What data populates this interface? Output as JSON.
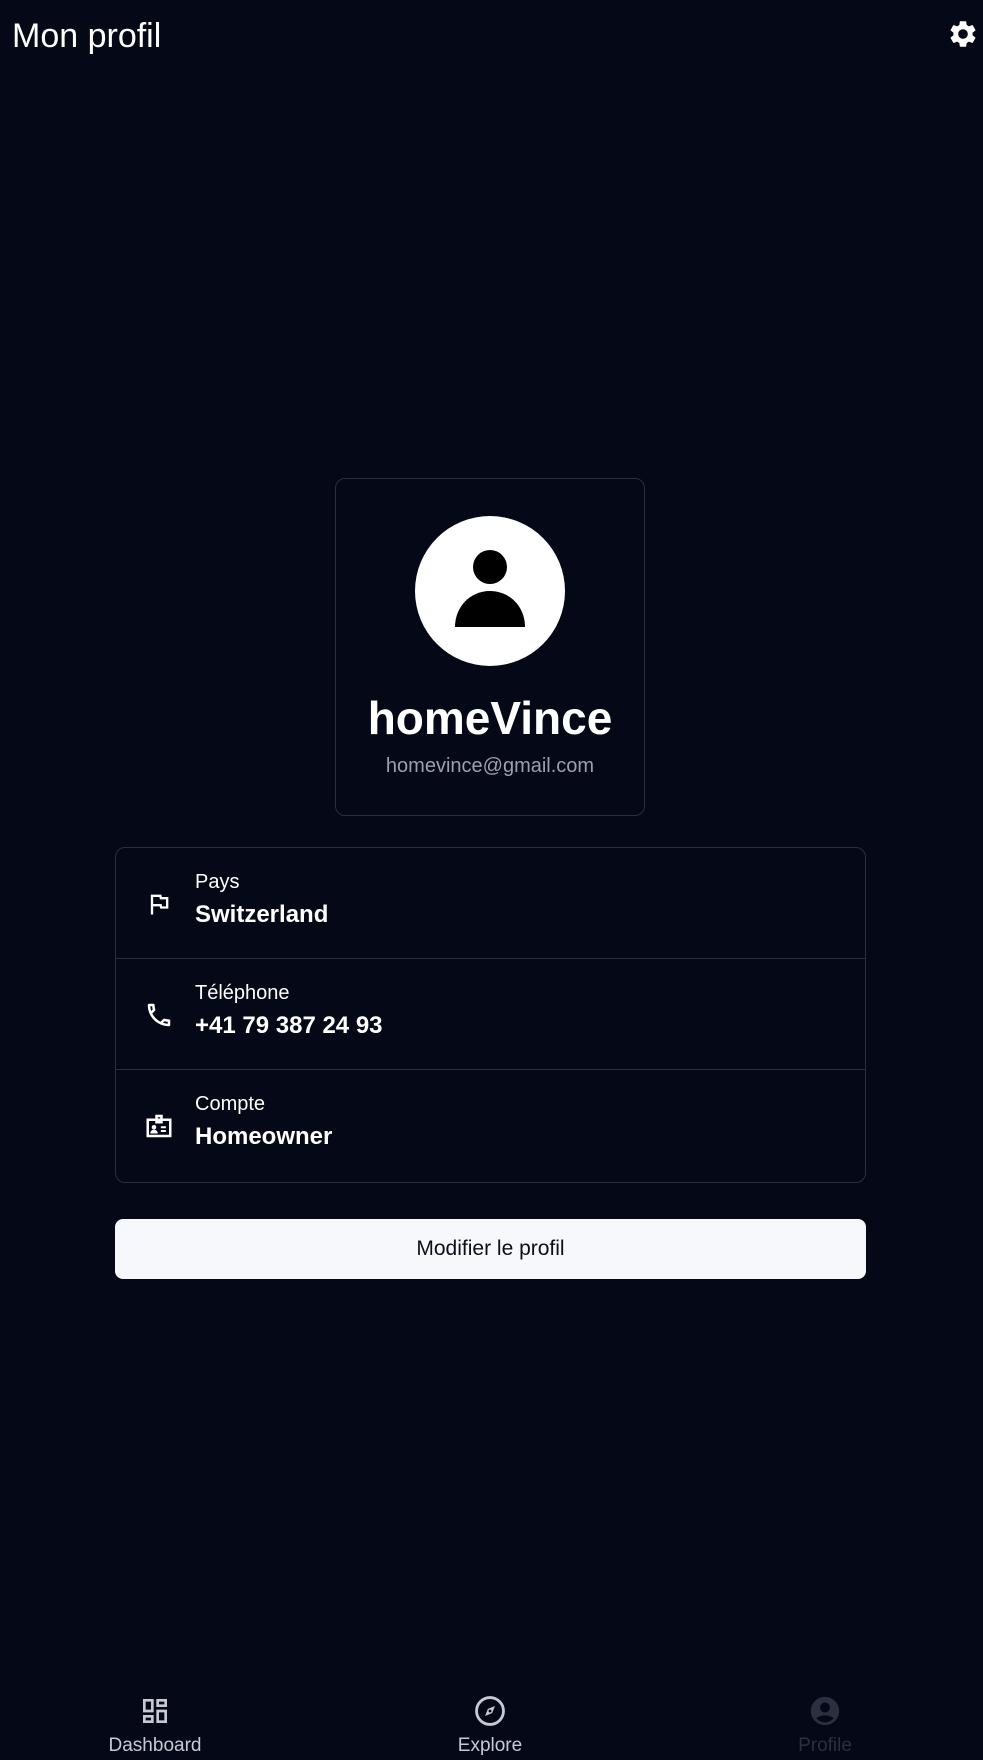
{
  "header": {
    "title": "Mon profil",
    "settings_icon": "gear-icon"
  },
  "profile": {
    "avatar_icon": "user-silhouette-icon",
    "username": "homeVince",
    "email": "homevince@gmail.com"
  },
  "info": [
    {
      "icon": "flag-icon",
      "label": "Pays",
      "value": "Switzerland"
    },
    {
      "icon": "phone-icon",
      "label": "Téléphone",
      "value": "+41 79 387 24 93"
    },
    {
      "icon": "id-badge-icon",
      "label": "Compte",
      "value": "Homeowner"
    }
  ],
  "actions": {
    "edit_label": "Modifier le profil"
  },
  "bottom_nav": {
    "items": [
      {
        "label": "Dashboard",
        "icon": "dashboard-icon",
        "active": false
      },
      {
        "label": "Explore",
        "icon": "compass-icon",
        "active": false
      },
      {
        "label": "Profile",
        "icon": "account-circle-icon",
        "active": true
      }
    ]
  },
  "colors": {
    "background": "#050816",
    "card_border": "#2a2f3d",
    "button_bg": "#f7f8fb",
    "muted_text": "#9aa0ad",
    "nav_inactive": "#c7cad3",
    "nav_active": "#2a3040"
  }
}
